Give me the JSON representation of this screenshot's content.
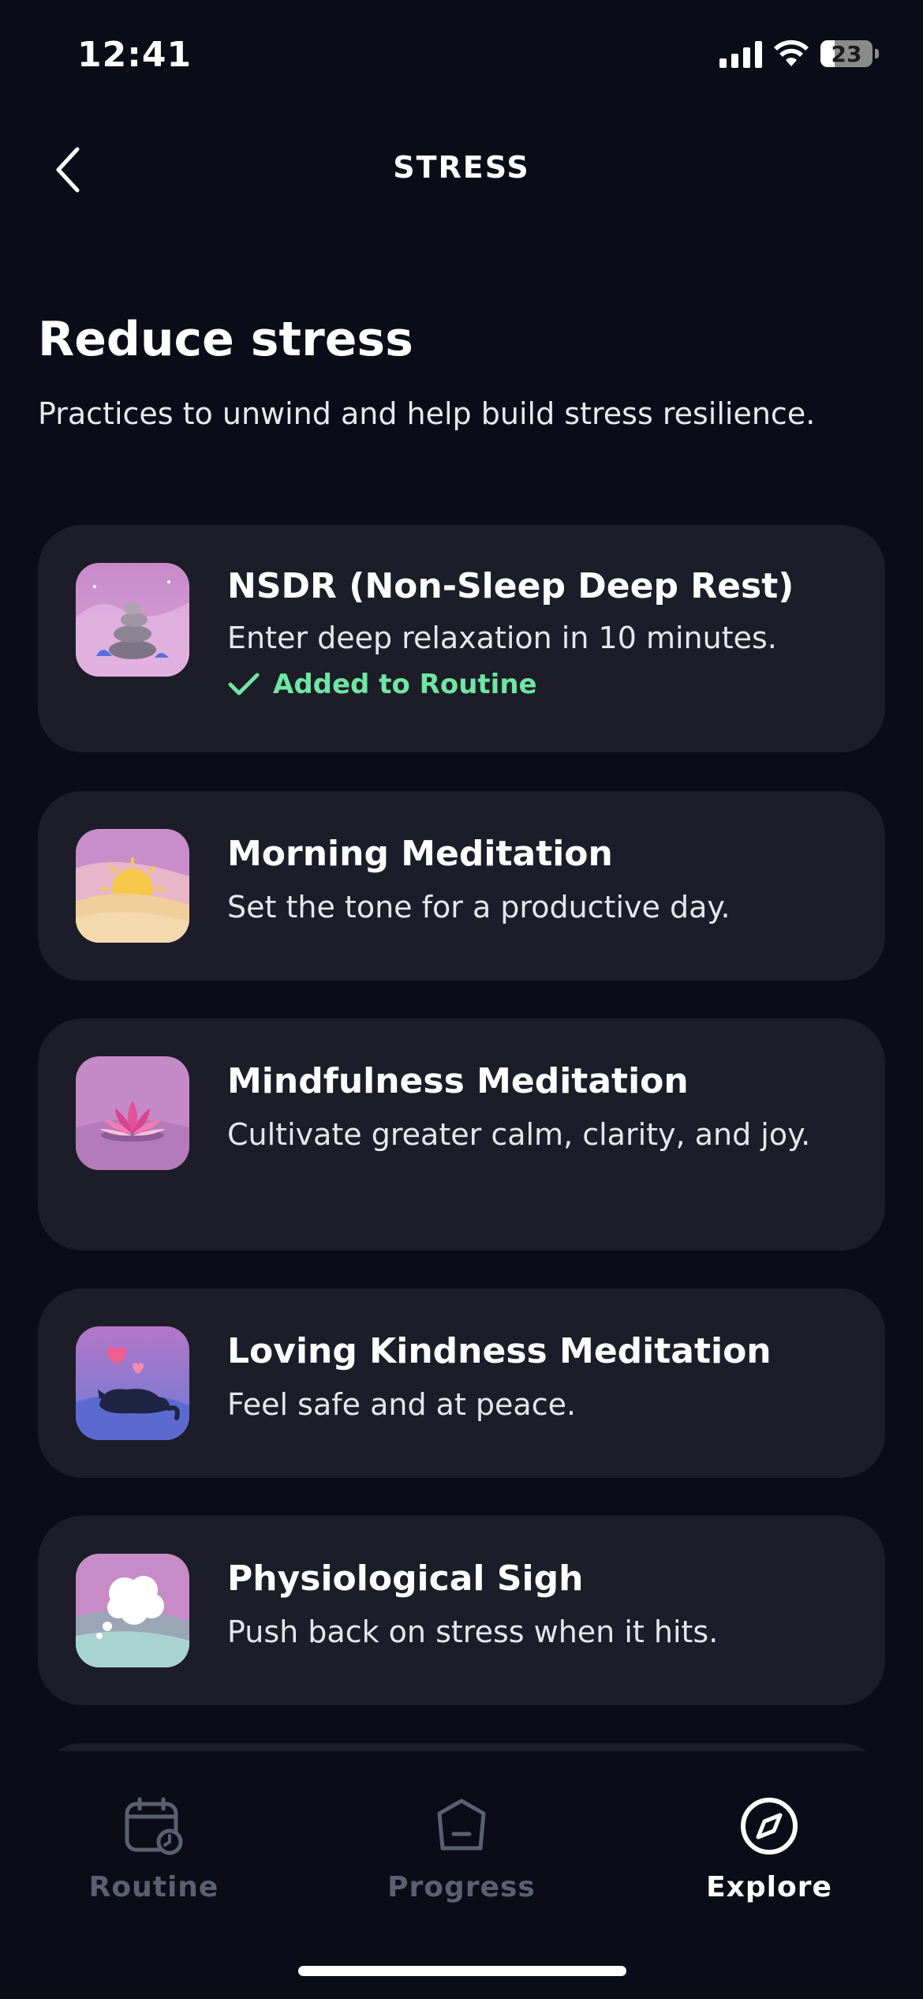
{
  "status_bar": {
    "time": "12:41",
    "battery": "23"
  },
  "header": {
    "title": "STRESS"
  },
  "intro": {
    "title": "Reduce stress",
    "subtitle": "Practices to unwind and help build stress resilience."
  },
  "cards": [
    {
      "title": "NSDR (Non-Sleep Deep Rest)",
      "description": "Enter deep relaxation in 10 minutes.",
      "status": "Added to Routine",
      "icon": "stacked-stones-icon"
    },
    {
      "title": "Morning Meditation",
      "description": "Set the tone for a productive day.",
      "icon": "sunrise-icon"
    },
    {
      "title": "Mindfulness Meditation",
      "description": "Cultivate greater calm, clarity, and joy.",
      "icon": "lotus-icon"
    },
    {
      "title": "Loving Kindness Meditation",
      "description": "Feel safe and at peace.",
      "icon": "sleeping-cat-hearts-icon"
    },
    {
      "title": "Physiological Sigh",
      "description": "Push back on stress when it hits.",
      "icon": "thought-cloud-icon"
    }
  ],
  "tabs": [
    {
      "label": "Routine",
      "icon": "calendar-clock-icon",
      "active": false
    },
    {
      "label": "Progress",
      "icon": "pentagon-badge-icon",
      "active": false
    },
    {
      "label": "Explore",
      "icon": "compass-icon",
      "active": true
    }
  ],
  "colors": {
    "background": "#0b0c17",
    "card": "#1c1d28",
    "accent_green": "#6fe6a3",
    "inactive_tab": "#5c5f70"
  }
}
